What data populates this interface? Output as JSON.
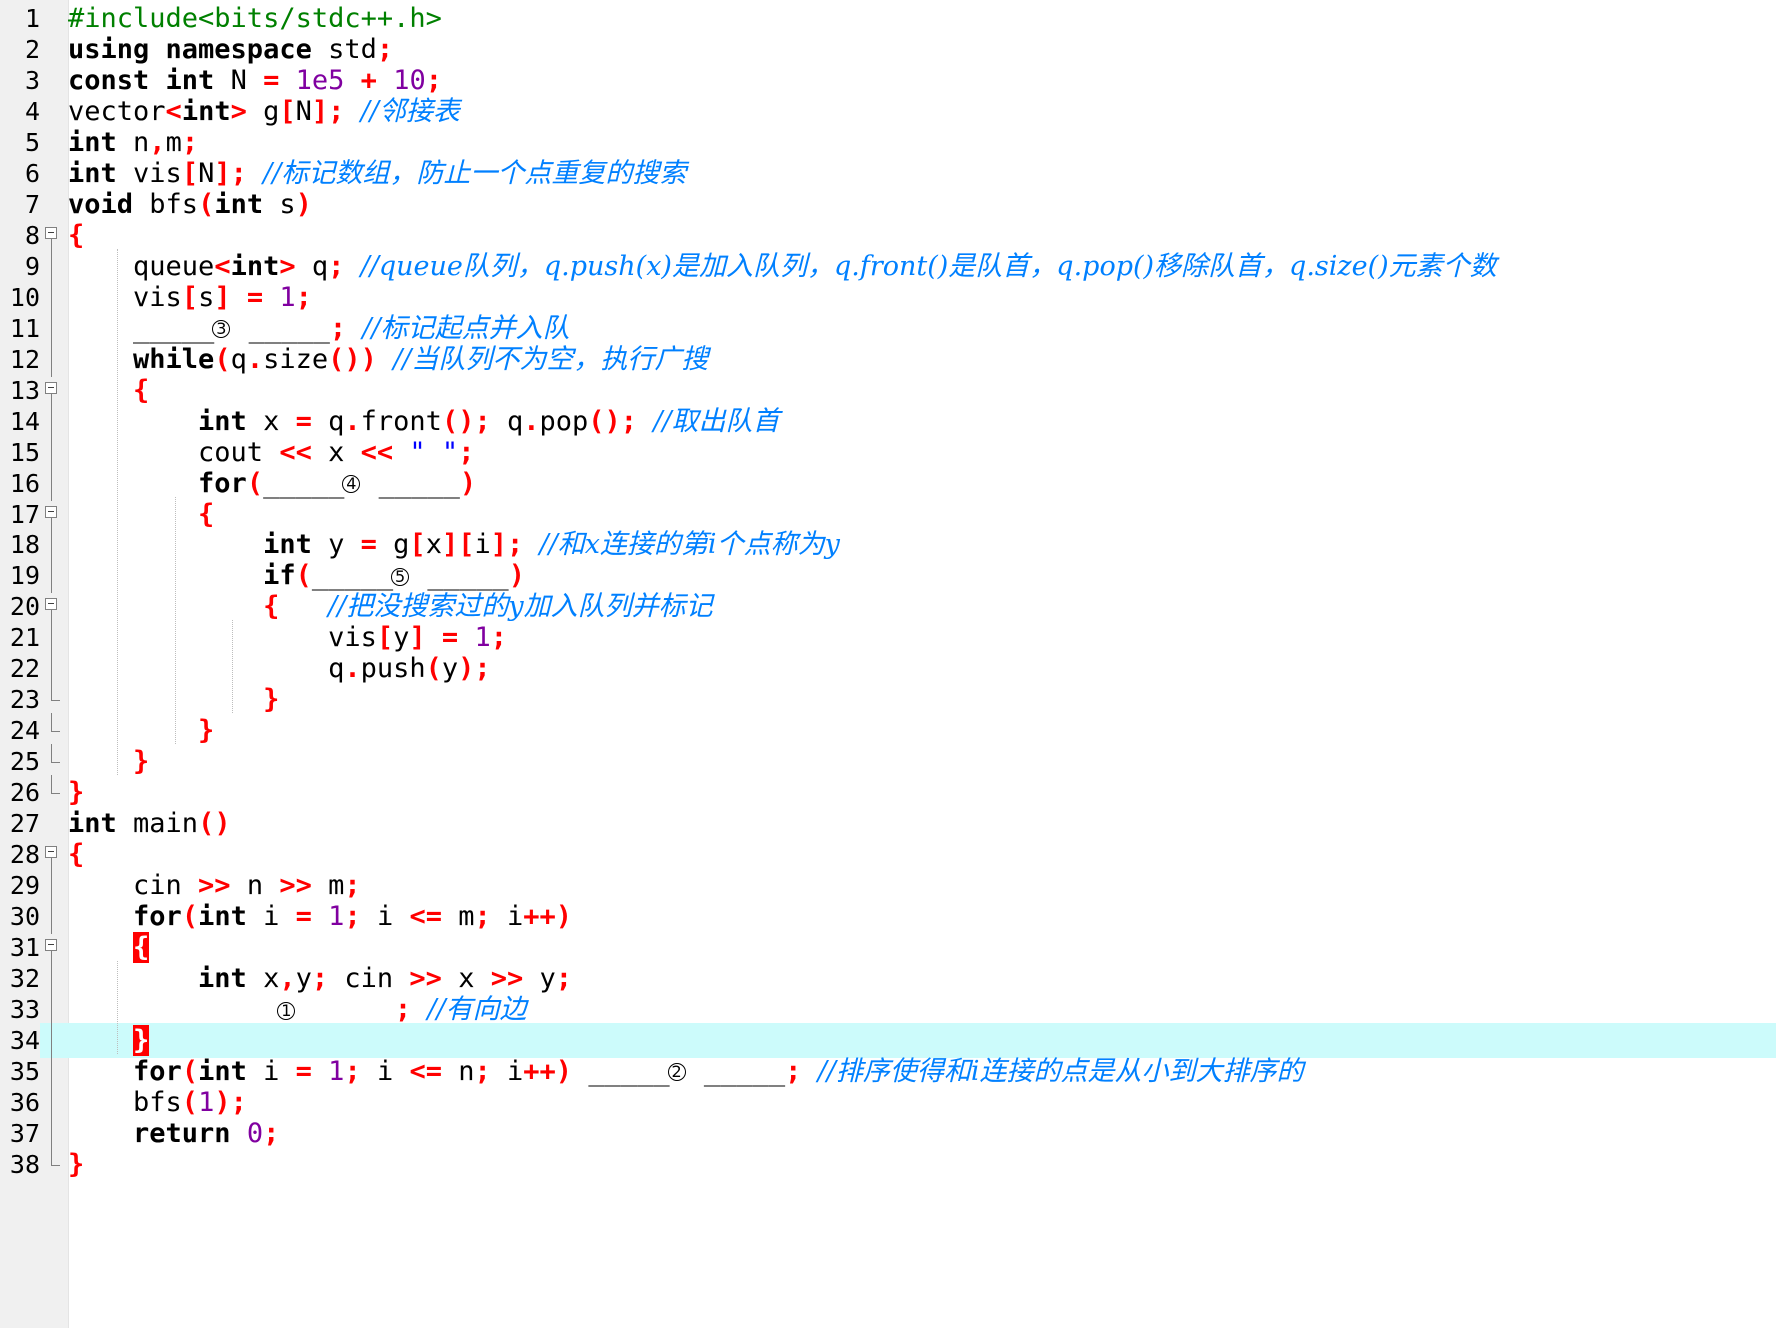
{
  "editor": {
    "current_line": 34,
    "lines": [
      {
        "n": "1",
        "html": "<span class=\"pp\">#include&lt;bits/stdc++.h&gt;</span>"
      },
      {
        "n": "2",
        "html": "<span class=\"kw\">using namespace</span> std<span class=\"op\">;</span>"
      },
      {
        "n": "3",
        "html": "<span class=\"kw\">const int</span> N <span class=\"op\">=</span> <span class=\"num\">1e5</span> <span class=\"op\">+</span> <span class=\"num\">10</span><span class=\"op\">;</span>"
      },
      {
        "n": "4",
        "html": "vector<span class=\"op\">&lt;</span><span class=\"kw\">int</span><span class=\"op\">&gt;</span> g<span class=\"op\">[</span>N<span class=\"op\">];</span> <span class=\"cm\">//邻接表</span>"
      },
      {
        "n": "5",
        "html": "<span class=\"kw\">int</span> n<span class=\"op\">,</span>m<span class=\"op\">;</span>"
      },
      {
        "n": "6",
        "html": "<span class=\"kw\">int</span> vis<span class=\"op\">[</span>N<span class=\"op\">];</span> <span class=\"cm\">//标记数组，防止一个点重复的搜索</span>"
      },
      {
        "n": "7",
        "html": "<span class=\"kw\">void</span> bfs<span class=\"op\">(</span><span class=\"kw\">int</span> s<span class=\"op\">)</span>"
      },
      {
        "n": "8",
        "html": "<span class=\"op\">{</span>"
      },
      {
        "n": "9",
        "html": "    queue<span class=\"op\">&lt;</span><span class=\"kw\">int</span><span class=\"op\">&gt;</span> q<span class=\"op\">;</span> <span class=\"cm\">//queue队列，q.push(x)是加入队列，q.front()是队首，q.pop()移除队首，q.size()元素个数</span>"
      },
      {
        "n": "10",
        "html": "    vis<span class=\"op\">[</span>s<span class=\"op\">]</span> <span class=\"op\">=</span> <span class=\"num\">1</span><span class=\"op\">;</span>"
      },
      {
        "n": "11",
        "html": "    _____<span class=\"mark\">3</span> _____<span class=\"op\">;</span> <span class=\"cm\">//标记起点并入队</span>"
      },
      {
        "n": "12",
        "html": "    <span class=\"kw\">while</span><span class=\"op\">(</span>q<span class=\"op\">.</span>size<span class=\"op\">())</span> <span class=\"cm\">//当队列不为空，执行广搜</span>"
      },
      {
        "n": "13",
        "html": "    <span class=\"op\">{</span>"
      },
      {
        "n": "14",
        "html": "        <span class=\"kw\">int</span> x <span class=\"op\">=</span> q<span class=\"op\">.</span>front<span class=\"op\">();</span> q<span class=\"op\">.</span>pop<span class=\"op\">();</span> <span class=\"cm\">//取出队首</span>"
      },
      {
        "n": "15",
        "html": "        cout <span class=\"op\">&lt;&lt;</span> x <span class=\"op\">&lt;&lt;</span> <span class=\"str\">\" \"</span><span class=\"op\">;</span>"
      },
      {
        "n": "16",
        "html": "        <span class=\"kw\">for</span><span class=\"op\">(</span>_____<span class=\"mark\">4</span> _____<span class=\"op\">)</span>"
      },
      {
        "n": "17",
        "html": "        <span class=\"op\">{</span>"
      },
      {
        "n": "18",
        "html": "            <span class=\"kw\">int</span> y <span class=\"op\">=</span> g<span class=\"op\">[</span>x<span class=\"op\">][</span>i<span class=\"op\">];</span> <span class=\"cm\">//和x连接的第i个点称为y</span>"
      },
      {
        "n": "19",
        "html": "            <span class=\"kw\">if</span><span class=\"op\">(</span>_____<span class=\"mark\">5</span> _____<span class=\"op\">)</span>"
      },
      {
        "n": "20",
        "html": "            <span class=\"op\">{</span>   <span class=\"cm\">//把没搜索过的y加入队列并标记</span>"
      },
      {
        "n": "21",
        "html": "                vis<span class=\"op\">[</span>y<span class=\"op\">]</span> <span class=\"op\">=</span> <span class=\"num\">1</span><span class=\"op\">;</span>"
      },
      {
        "n": "22",
        "html": "                q<span class=\"op\">.</span>push<span class=\"op\">(</span>y<span class=\"op\">);</span>"
      },
      {
        "n": "23",
        "html": "            <span class=\"op\">}</span>"
      },
      {
        "n": "24",
        "html": "        <span class=\"op\">}</span>"
      },
      {
        "n": "25",
        "html": "    <span class=\"op\">}</span>"
      },
      {
        "n": "26",
        "html": "<span class=\"op\">}</span>"
      },
      {
        "n": "27",
        "html": "<span class=\"kw\">int</span> main<span class=\"op\">()</span>"
      },
      {
        "n": "28",
        "html": "<span class=\"op\">{</span>"
      },
      {
        "n": "29",
        "html": "    cin <span class=\"op\">&gt;&gt;</span> n <span class=\"op\">&gt;&gt;</span> m<span class=\"op\">;</span>"
      },
      {
        "n": "30",
        "html": "    <span class=\"kw\">for</span><span class=\"op\">(</span><span class=\"kw\">int</span> i <span class=\"op\">=</span> <span class=\"num\">1</span><span class=\"op\">;</span> i <span class=\"op\">&lt;=</span> m<span class=\"op\">;</span> i<span class=\"op\">++)</span>"
      },
      {
        "n": "31",
        "html": "    <span class=\"bracehl\">{</span>"
      },
      {
        "n": "32",
        "html": "        <span class=\"kw\">int</span> x<span class=\"op\">,</span>y<span class=\"op\">;</span> cin <span class=\"op\">&gt;&gt;</span> x <span class=\"op\">&gt;&gt;</span> y<span class=\"op\">;</span>"
      },
      {
        "n": "33",
        "html": "        _____<span class=\"mark\">1</span> _____<span class=\"op\">;</span> <span class=\"cm\">//有向边</span>"
      },
      {
        "n": "34",
        "html": "    <span class=\"bracehl\">}</span>"
      },
      {
        "n": "35",
        "html": "    <span class=\"kw\">for</span><span class=\"op\">(</span><span class=\"kw\">int</span> i <span class=\"op\">=</span> <span class=\"num\">1</span><span class=\"op\">;</span> i <span class=\"op\">&lt;=</span> n<span class=\"op\">;</span> i<span class=\"op\">++)</span> _____<span class=\"mark\">2</span> _____<span class=\"op\">;</span> <span class=\"cm\">//排序使得和i连接的点是从小到大排序的</span>"
      },
      {
        "n": "36",
        "html": "    bfs<span class=\"op\">(</span><span class=\"num\">1</span><span class=\"op\">);</span>"
      },
      {
        "n": "37",
        "html": "    <span class=\"kw\">return</span> <span class=\"num\">0</span><span class=\"op\">;</span>"
      },
      {
        "n": "38",
        "html": "<span class=\"op\">}</span>"
      }
    ]
  }
}
